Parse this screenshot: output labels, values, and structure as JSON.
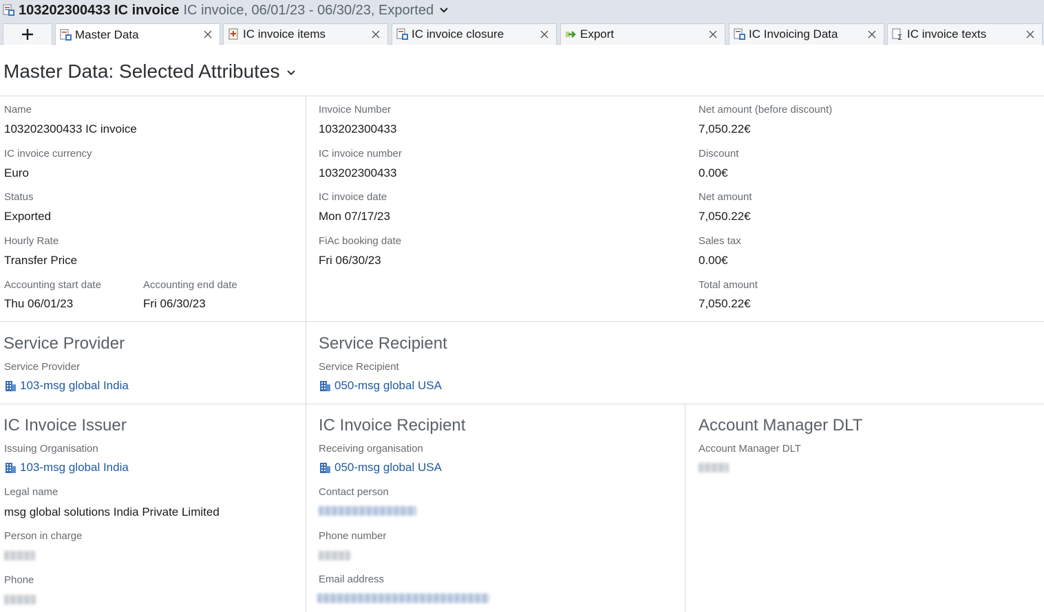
{
  "title": {
    "main": "103202300433 IC invoice",
    "sub": "IC invoice, 06/01/23 - 06/30/23, Exported"
  },
  "tabs": [
    {
      "label": "Master Data",
      "icon": "invoice-icon"
    },
    {
      "label": "IC invoice items",
      "icon": "items-icon"
    },
    {
      "label": "IC invoice closure",
      "icon": "invoice-icon"
    },
    {
      "label": "Export",
      "icon": "export-arrow-icon"
    },
    {
      "label": "IC Invoicing Data",
      "icon": "invoice-icon"
    },
    {
      "label": "IC invoice texts",
      "icon": "texts-icon"
    }
  ],
  "page_title": "Master Data: Selected Attributes",
  "master": {
    "name_label": "Name",
    "name_value": "103202300433 IC invoice",
    "currency_label": "IC invoice currency",
    "currency_value": "Euro",
    "status_label": "Status",
    "status_value": "Exported",
    "hourly_label": "Hourly Rate",
    "hourly_value": "Transfer Price",
    "acc_start_label": "Accounting start date",
    "acc_start_value": "Thu 06/01/23",
    "acc_end_label": "Accounting end date",
    "acc_end_value": "Fri 06/30/23",
    "inv_number_label": "Invoice Number",
    "inv_number_value": "103202300433",
    "ic_inv_number_label": "IC invoice number",
    "ic_inv_number_value": "103202300433",
    "ic_inv_date_label": "IC invoice date",
    "ic_inv_date_value": "Mon 07/17/23",
    "fiac_label": "FiAc booking date",
    "fiac_value": "Fri 06/30/23",
    "net_before_label": "Net amount (before discount)",
    "net_before_value": "7,050.22€",
    "discount_label": "Discount",
    "discount_value": "0.00€",
    "net_label": "Net amount",
    "net_value": "7,050.22€",
    "tax_label": "Sales tax",
    "tax_value": "0.00€",
    "total_label": "Total amount",
    "total_value": "7,050.22€"
  },
  "service_provider": {
    "heading": "Service Provider",
    "label": "Service Provider",
    "value": "103-msg global India"
  },
  "service_recipient": {
    "heading": "Service Recipient",
    "label": "Service Recipient",
    "value": "050-msg global USA"
  },
  "issuer": {
    "heading": "IC Invoice Issuer",
    "org_label": "Issuing Organisation",
    "org_value": "103-msg global India",
    "legal_label": "Legal name",
    "legal_value": "msg global solutions India Private Limited",
    "person_label": "Person in charge",
    "phone_label": "Phone"
  },
  "recipient": {
    "heading": "IC Invoice Recipient",
    "org_label": "Receiving organisation",
    "org_value": "050-msg global USA",
    "contact_label": "Contact person",
    "phone_label": "Phone number",
    "email_label": "Email address"
  },
  "account_manager": {
    "heading": "Account Manager DLT",
    "label": "Account Manager DLT"
  },
  "colors": {
    "link": "#1f5aa0",
    "tabbar": "#dfe4ea"
  }
}
